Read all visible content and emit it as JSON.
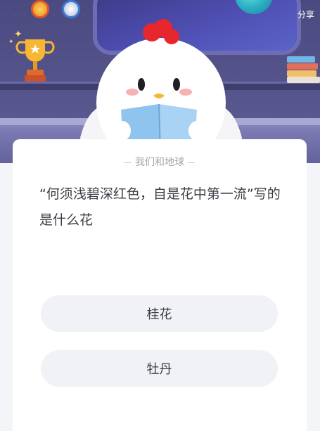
{
  "header": {
    "share_label": "分享",
    "icons": [
      "gold-medal-icon",
      "silver-medal-icon",
      "trophy-icon",
      "books-icon",
      "planet-icon",
      "chick-mascot"
    ]
  },
  "quiz": {
    "topic": "我们和地球",
    "question": "“何须浅碧深红色，自是花中第一流”写的是什么花",
    "options": [
      {
        "label": "桂花"
      },
      {
        "label": "牡丹"
      }
    ]
  },
  "colors": {
    "scene_bg": "#4b4a80",
    "card_bg": "#ffffff",
    "option_bg": "#f0f2f5",
    "text_main": "#3b3e45",
    "text_muted": "#a3a6ad",
    "mascot_comb": "#e8262d",
    "mascot_book": "#8fc4ef"
  }
}
